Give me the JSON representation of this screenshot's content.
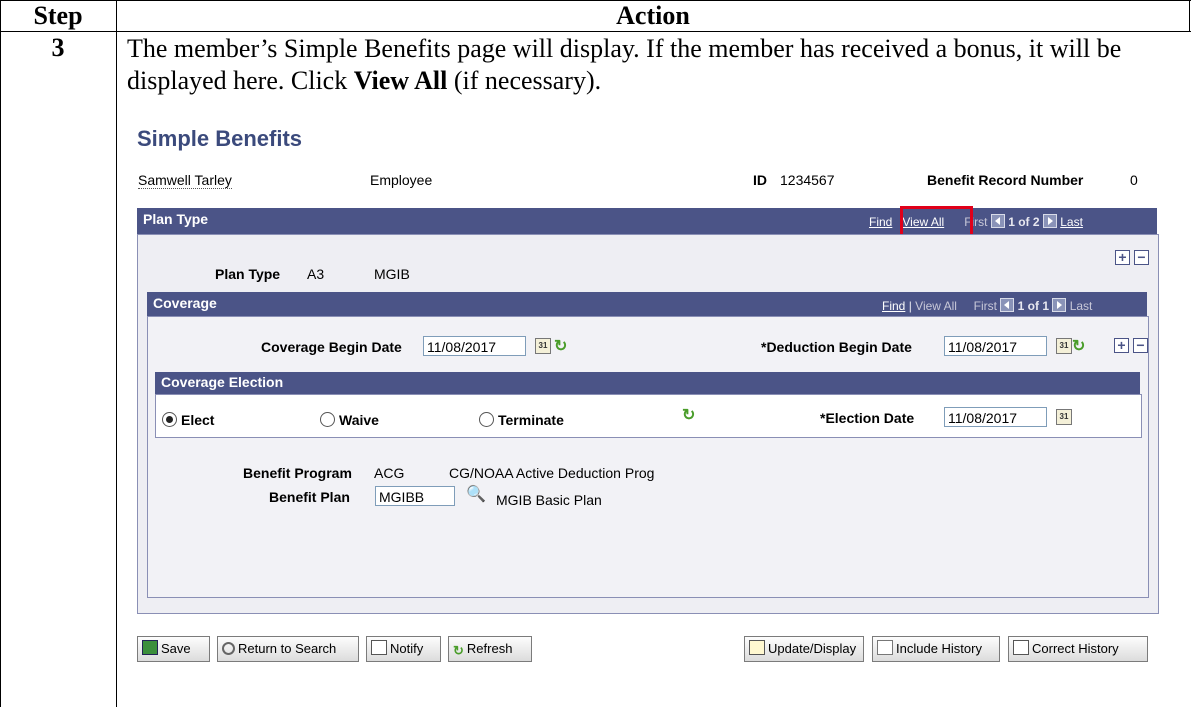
{
  "table": {
    "col_step": "Step",
    "col_action": "Action",
    "step_number": "3",
    "instruction_part1": "The member’s Simple Benefits page will display.  If the member has received a bonus, it will be displayed here.  Click ",
    "instruction_bold": "View All",
    "instruction_part2": " (if necessary)."
  },
  "screen": {
    "title": "Simple Benefits",
    "employee_name": "Samwell Tarley",
    "employee_type": "Employee",
    "id_label": "ID",
    "id_value": "1234567",
    "brn_label": "Benefit Record Number",
    "brn_value": "0",
    "plan_type_bar": {
      "label": "Plan Type",
      "find": "Find",
      "view_all": "View All",
      "first": "First",
      "count": "1 of 2",
      "last": "Last"
    },
    "plan_type_label": "Plan Type",
    "plan_type_code": "A3",
    "plan_type_desc": "MGIB",
    "coverage_bar": {
      "label": "Coverage",
      "find": "Find",
      "sep": "|",
      "view_all": "View All",
      "first": "First",
      "count": "1 of 1",
      "last": "Last"
    },
    "coverage_begin_label": "Coverage Begin Date",
    "coverage_begin_value": "11/08/2017",
    "deduction_begin_label": "*Deduction Begin Date",
    "deduction_begin_value": "11/08/2017",
    "election_bar": {
      "label": "Coverage Election"
    },
    "radios": {
      "elect": "Elect",
      "waive": "Waive",
      "terminate": "Terminate"
    },
    "election_date_label": "*Election Date",
    "election_date_value": "11/08/2017",
    "benefit_program_label": "Benefit Program",
    "benefit_program_code": "ACG",
    "benefit_program_desc": "CG/NOAA Active Deduction Prog",
    "benefit_plan_label": "Benefit Plan",
    "benefit_plan_value": "MGIBB",
    "benefit_plan_desc": "MGIB Basic Plan",
    "buttons": {
      "save": "Save",
      "return": "Return to Search",
      "notify": "Notify",
      "refresh": "Refresh",
      "update": "Update/Display",
      "include": "Include History",
      "correct": "Correct History"
    },
    "calendar_glyph": "31",
    "plus": "+",
    "minus": "−",
    "refresh_glyph": "↻",
    "search_glyph": "🔍"
  }
}
